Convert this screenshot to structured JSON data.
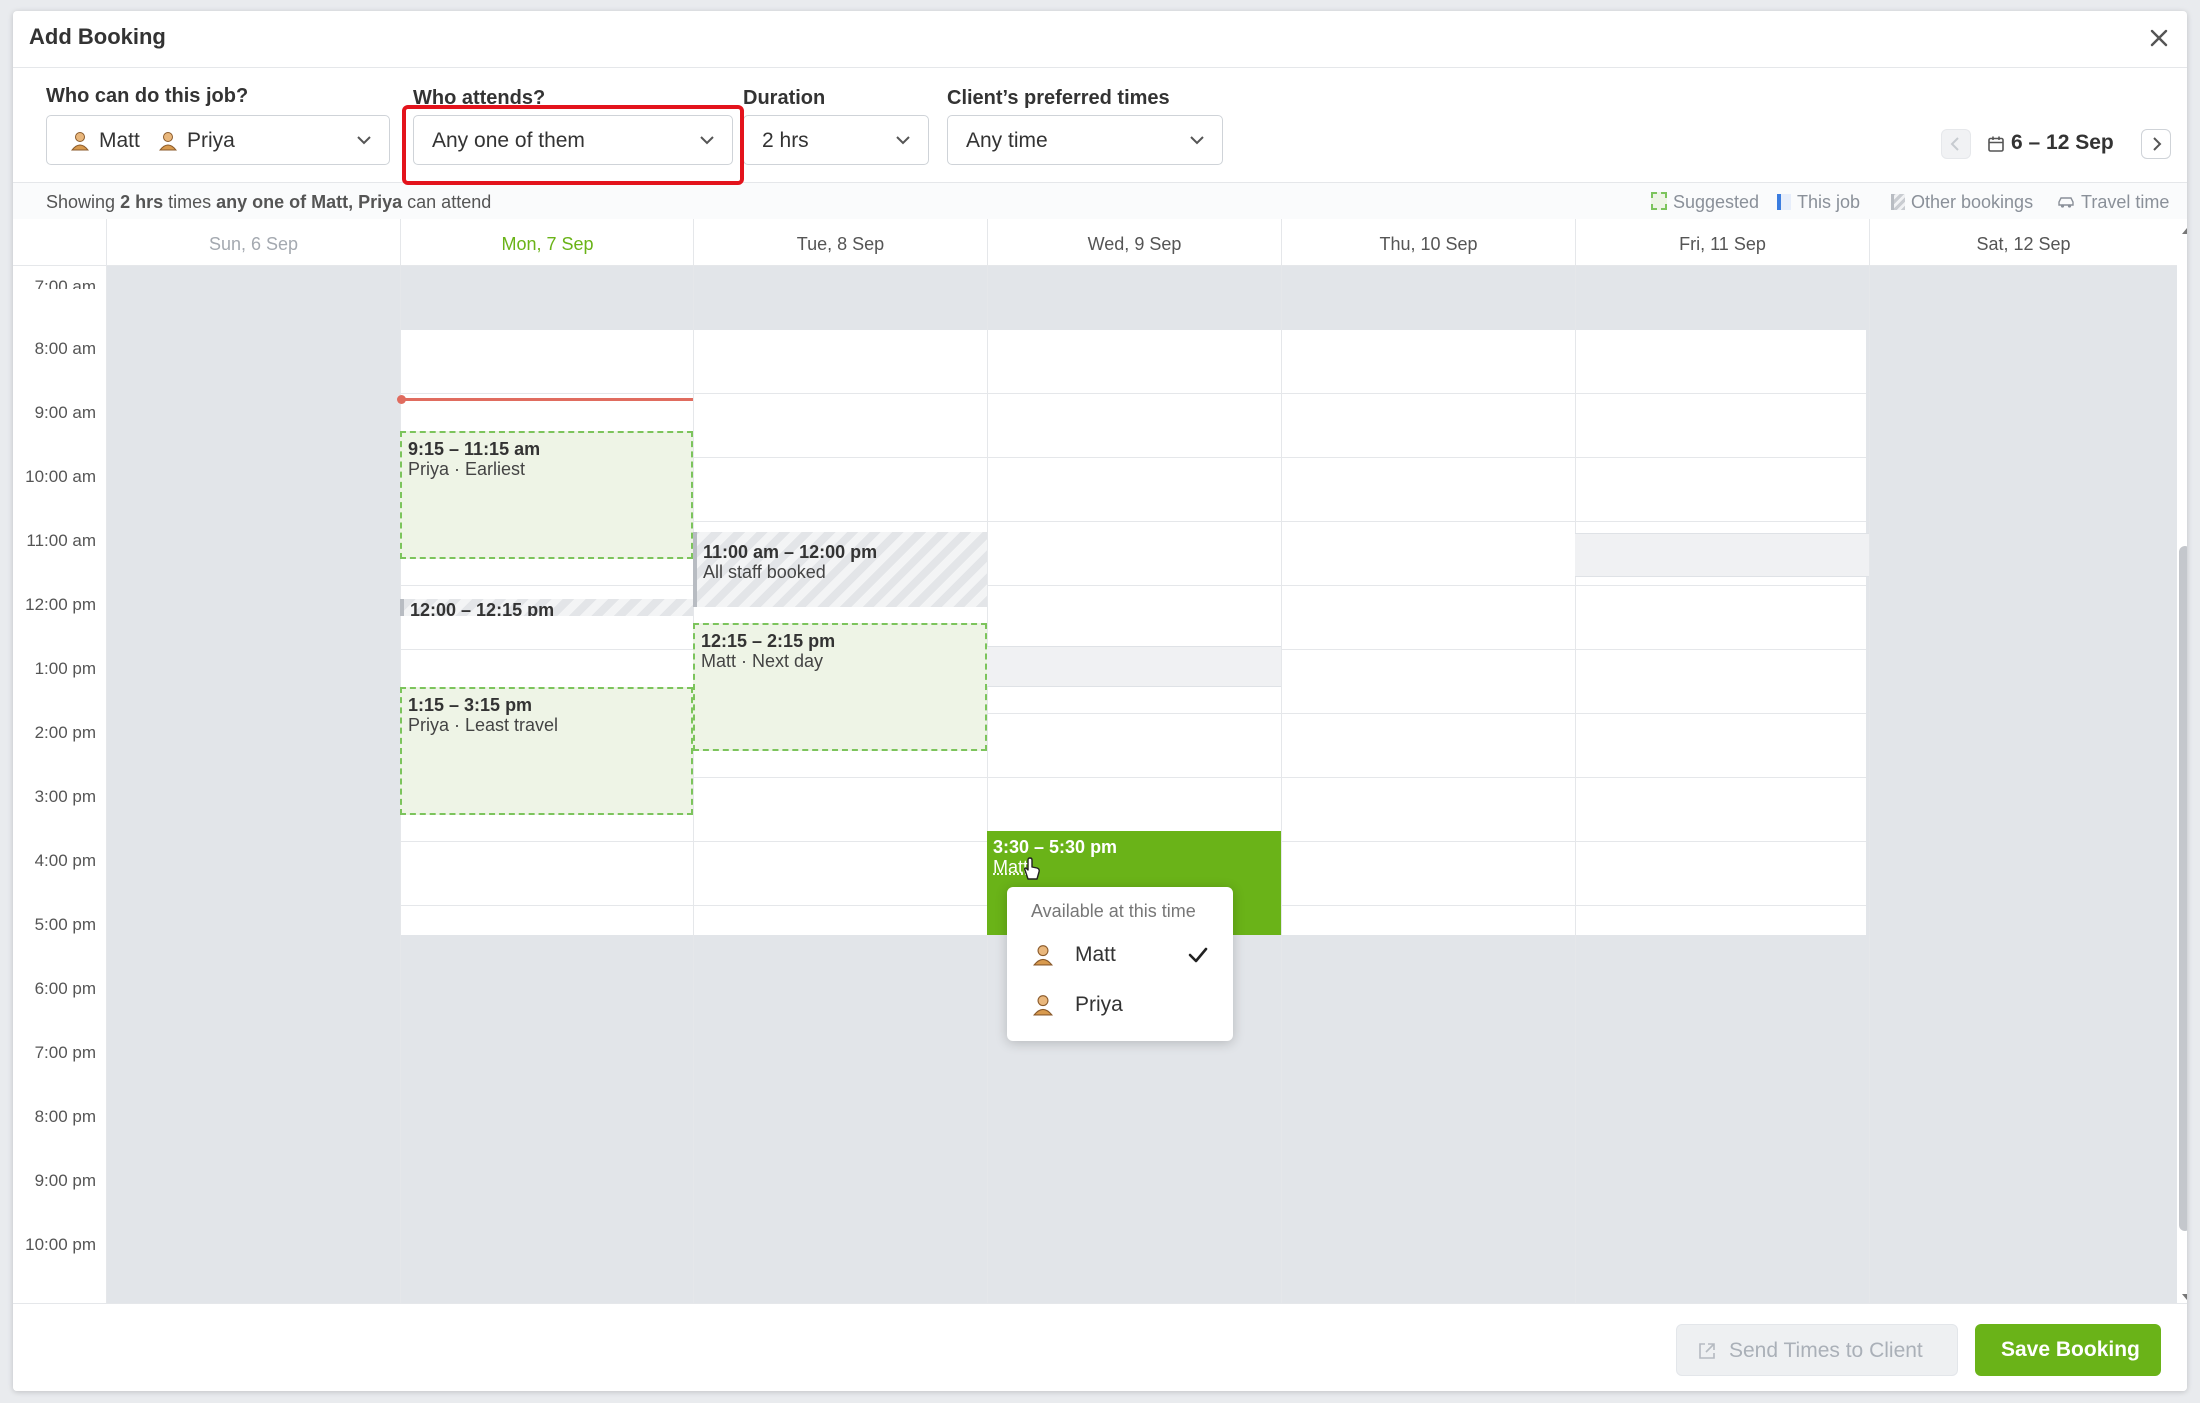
{
  "dialog": {
    "title": "Add Booking"
  },
  "filters": {
    "who_label": "Who can do this job?",
    "who_values": [
      "Matt",
      "Priya"
    ],
    "attends_label": "Who attends?",
    "attends_value": "Any one of them",
    "duration_label": "Duration",
    "duration_value": "2 hrs",
    "preferred_label": "Client’s preferred times",
    "preferred_value": "Any time"
  },
  "date_nav": {
    "range": "6 – 12 Sep"
  },
  "info_bar": {
    "prefix": "Showing ",
    "duration": "2 hrs",
    "middle": " times ",
    "who": "any one of Matt, Priya",
    "suffix": " can attend"
  },
  "legend": {
    "suggested": "Suggested",
    "this_job": "This job",
    "other_bookings": "Other bookings",
    "travel_time": "Travel time"
  },
  "days": [
    {
      "label": "Sun, 6 Sep",
      "state": "past"
    },
    {
      "label": "Mon, 7 Sep",
      "state": "today"
    },
    {
      "label": "Tue, 8 Sep",
      "state": "normal"
    },
    {
      "label": "Wed, 9 Sep",
      "state": "normal"
    },
    {
      "label": "Thu, 10 Sep",
      "state": "normal"
    },
    {
      "label": "Fri, 11 Sep",
      "state": "normal"
    },
    {
      "label": "Sat, 12 Sep",
      "state": "normal"
    }
  ],
  "times": [
    "7:00 am",
    "8:00 am",
    "9:00 am",
    "10:00 am",
    "11:00 am",
    "12:00 pm",
    "1:00 pm",
    "2:00 pm",
    "3:00 pm",
    "4:00 pm",
    "5:00 pm",
    "6:00 pm",
    "7:00 pm",
    "8:00 pm",
    "9:00 pm",
    "10:00 pm"
  ],
  "events": {
    "mon_earliest": {
      "time": "9:15 – 11:15 am",
      "desc": "Priya · Earliest"
    },
    "mon_busy": {
      "time": "12:00 – 12:15 pm"
    },
    "mon_least_travel": {
      "time": "1:15 – 3:15 pm",
      "desc": "Priya · Least travel"
    },
    "tue_booked": {
      "time": "11:00 am – 12:00 pm",
      "desc": "All staff booked"
    },
    "tue_next_day": {
      "time": "12:15 – 2:15 pm",
      "desc": "Matt · Next day"
    },
    "wed_this_job": {
      "time": "3:30 – 5:30 pm",
      "desc": "Matt"
    }
  },
  "popup": {
    "heading": "Available at this time",
    "options": [
      {
        "name": "Matt",
        "selected": true
      },
      {
        "name": "Priya",
        "selected": false
      }
    ]
  },
  "footer": {
    "send_label": "Send Times to Client",
    "save_label": "Save Booking"
  },
  "colors": {
    "accent_green": "#6ab318",
    "suggested_border": "#7cc45c",
    "highlight_red": "#e3131c",
    "today_green": "#6ab318"
  }
}
